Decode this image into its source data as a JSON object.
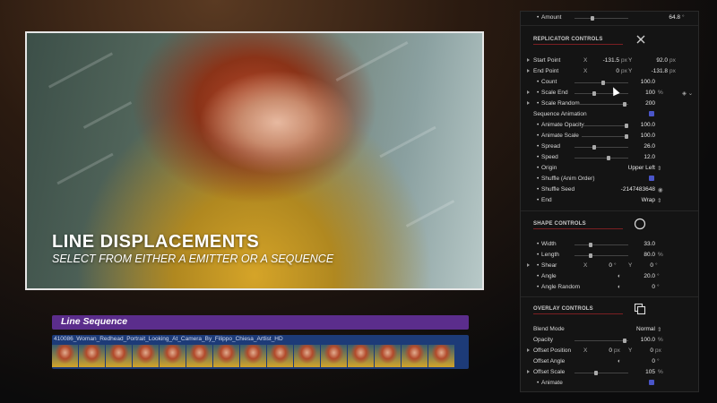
{
  "viewer": {
    "title": "LINE DISPLACEMENTS",
    "subtitle": "SELECT FROM EITHER A EMITTER OR A SEQUENCE"
  },
  "timeline": {
    "sequence_label": "Line Sequence",
    "clip_name": "410086_Woman_Redhead_Portrait_Looking_At_Camera_By_Filippo_Chiesa_Artlist_HD"
  },
  "inspector": {
    "amount": {
      "label": "Amount",
      "value": "64.8",
      "unit": "°"
    },
    "replicator_header": "REPLICATOR CONTROLS",
    "start_point": {
      "label": "Start Point",
      "x_axis": "X",
      "x": "-131.5",
      "x_unit": "px",
      "y_axis": "Y",
      "y": "92.0",
      "y_unit": "px"
    },
    "end_point": {
      "label": "End Point",
      "x_axis": "X",
      "x": "0",
      "x_unit": "px",
      "y_axis": "Y",
      "y": "-131.8",
      "y_unit": "px"
    },
    "count": {
      "label": "Count",
      "value": "100.0"
    },
    "scale_end": {
      "label": "Scale End",
      "value": "100",
      "unit": "%"
    },
    "scale_random": {
      "label": "Scale Random",
      "value": "200"
    },
    "sequence_animation": {
      "label": "Sequence Animation"
    },
    "animate_opacity": {
      "label": "Animate Opacity",
      "value": "100.0"
    },
    "animate_scale": {
      "label": "Animate Scale",
      "value": "100.0"
    },
    "spread": {
      "label": "Spread",
      "value": "26.0"
    },
    "speed": {
      "label": "Speed",
      "value": "12.0"
    },
    "origin": {
      "label": "Origin",
      "value": "Upper Left"
    },
    "shuffle_anim_order": {
      "label": "Shuffle (Anim Order)"
    },
    "shuffle_seed": {
      "label": "Shuffle Seed",
      "value": "-2147483648"
    },
    "end": {
      "label": "End",
      "value": "Wrap"
    },
    "shape_header": "SHAPE CONTROLS",
    "width": {
      "label": "Width",
      "value": "33.0"
    },
    "length": {
      "label": "Length",
      "value": "80.0",
      "unit": "%"
    },
    "shear": {
      "label": "Shear",
      "x_axis": "X",
      "x": "0",
      "x_unit": "°",
      "y_axis": "Y",
      "y": "0",
      "y_unit": "°"
    },
    "angle": {
      "label": "Angle",
      "value": "20.0",
      "unit": "°"
    },
    "angle_random": {
      "label": "Angle Random",
      "value": "0",
      "unit": "°"
    },
    "overlay_header": "OVERLAY CONTROLS",
    "blend_mode": {
      "label": "Blend Mode",
      "value": "Normal"
    },
    "opacity": {
      "label": "Opacity",
      "value": "100.0",
      "unit": "%"
    },
    "offset_position": {
      "label": "Offset Position",
      "x_axis": "X",
      "x": "0",
      "x_unit": "px",
      "y_axis": "Y",
      "y": "0",
      "y_unit": "px"
    },
    "offset_angle": {
      "label": "Offset Angle",
      "value": "0",
      "unit": "°"
    },
    "offset_scale": {
      "label": "Offset Scale",
      "value": "105",
      "unit": "%"
    },
    "animate": {
      "label": "Animate"
    }
  },
  "colors": {
    "accent": "#5b2d8c",
    "track": "#1d3b78",
    "checkbox": "#4a55c8",
    "section_line": "#7b1f22"
  }
}
